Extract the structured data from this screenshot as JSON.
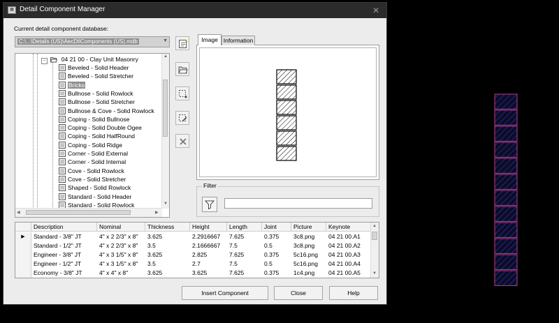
{
  "window": {
    "title": "Detail Component Manager",
    "icon": "dialog-icon",
    "close": "✕"
  },
  "database": {
    "label": "Current detail component database:",
    "value": "C:\\...\\Details (US)\\AecDtlComponents (US).mdb"
  },
  "tree": {
    "parent": "04 21 00 - Clay Unit Masonry",
    "items": [
      "Beveled - Solid Header",
      "Beveled - Solid Stretcher",
      "Bricks",
      "Bullnose - Solid Rowlock",
      "Bullnose - Solid Stretcher",
      "Bullnose & Cove - Solid Rowlock",
      "Coping - Solid Bullnose",
      "Coping - Solid Double Ogee",
      "Coping - Solid HalfRound",
      "Coping - Solid Ridge",
      "Corner - Solid External",
      "Corner - Solid Internal",
      "Cove - Solid Rowlock",
      "Cove - Solid Stretcher",
      "Shaped - Solid Rowlock",
      "Standard - Solid Header",
      "Standard - Solid Rowlock"
    ],
    "selected": "Bricks"
  },
  "tabs": {
    "image": "Image",
    "information": "Information"
  },
  "preview": {
    "brick_count": 6
  },
  "filter": {
    "label": "Filter",
    "value": ""
  },
  "grid": {
    "columns": [
      "Description",
      "Nominal",
      "Thickness",
      "Height",
      "Length",
      "Joint",
      "Picture",
      "Keynote"
    ],
    "rows": [
      [
        "Standard - 3/8\" JT",
        "4\" x 2 2/3\" x 8\"",
        "3.625",
        "2.2916667",
        "7.625",
        "0.375",
        "3c8.png",
        "04 21 00.A1"
      ],
      [
        "Standard - 1/2\" JT",
        "4\" x 2 2/3\" x 8\"",
        "3.5",
        "2.1666667",
        "7.5",
        "0.5",
        "3c8.png",
        "04 21 00.A2"
      ],
      [
        "Engineer - 3/8\" JT",
        "4\" x 3 1/5\" x 8\"",
        "3.625",
        "2.825",
        "7.625",
        "0.375",
        "5c16.png",
        "04 21 00.A3"
      ],
      [
        "Engineer - 1/2\" JT",
        "4\" x 3 1/5\" x 8\"",
        "3.5",
        "2.7",
        "7.5",
        "0.5",
        "5c16.png",
        "04 21 00.A4"
      ],
      [
        "Economy - 3/8\" JT",
        "4\" x 4\" x 8\"",
        "3.625",
        "3.625",
        "7.625",
        "0.375",
        "1c4.png",
        "04 21 00.A5"
      ]
    ],
    "current_row_marker": "▶"
  },
  "buttons": {
    "insert": "Insert Component",
    "close": "Close",
    "help": "Help"
  },
  "drawing": {
    "brick_count": 12,
    "stroke": "#b04090",
    "hatch": "#3a3a9a",
    "fill": "#0c0c2a"
  },
  "colors": {
    "dialog_bg": "#ececec",
    "selection": "#8e8e8e"
  }
}
